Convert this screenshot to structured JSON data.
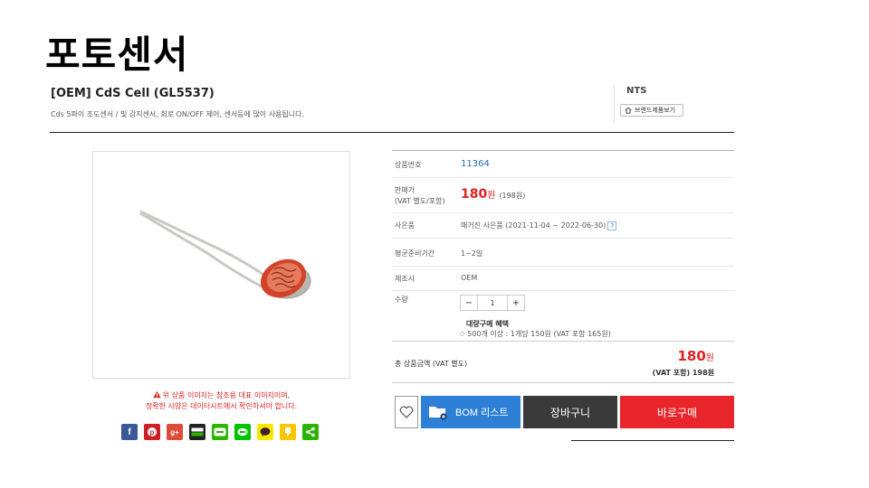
{
  "slide": {
    "title": "포토센서"
  },
  "product": {
    "name": "[OEM] CdS Cell (GL5537)",
    "description": "Cds 5파이 조도센서 / 빛 감지센서, 회로 ON/OFF 제어, 센서등에 많이 사용됩니다."
  },
  "brand": {
    "name": "NTS",
    "button_label": "브랜드제품보기",
    "icon": "home-icon"
  },
  "image_notice": {
    "line1": "위 상품 이미지는 참조용 대표 이미지이며,",
    "line2": "정확한 사양은 데이터시트에서 확인하셔야 합니다.",
    "icon": "warning-icon"
  },
  "share_icons": [
    "facebook-icon",
    "pinterest-icon",
    "google-plus-icon",
    "band-icon",
    "blog-icon",
    "line-icon",
    "kakaotalk-icon",
    "kakaostory-icon",
    "share-icon"
  ],
  "info": {
    "code_label": "상품번호",
    "code": "11364",
    "price_label": "판매가",
    "price_label_sub": "(VAT 별도/포함)",
    "price": "180",
    "price_unit": "원",
    "price_vat": "(198원)",
    "used_label": "사은품",
    "used_value": "매거진 사은품 (2021-11-04 ~ 2022-06-30)",
    "used_help": "?",
    "lead_label": "평균준비기간",
    "lead_value": "1~2일",
    "maker_label": "제조사",
    "maker_value": "OEM",
    "qty_label": "수량",
    "qty_minus": "−",
    "qty_value": "1",
    "qty_plus": "+",
    "bulk_title": "대량구매 혜택",
    "bulk_item": "500개 이상 : 1개당 150원 (VAT 포함 165원)"
  },
  "total": {
    "label": "총 상품금액 (VAT 별도)",
    "price": "180",
    "unit": "원",
    "vat": "(VAT 포함) 198원"
  },
  "actions": {
    "wishlist_icon": "heart-icon",
    "bom_label": "BOM 리스트",
    "cart_label": "장바구니",
    "buy_label": "바로구매"
  },
  "colors": {
    "accent_red": "#e8262b",
    "bom_blue": "#2e80d6",
    "cart_dark": "#3a3a3a",
    "code_blue": "#2d6db5"
  }
}
